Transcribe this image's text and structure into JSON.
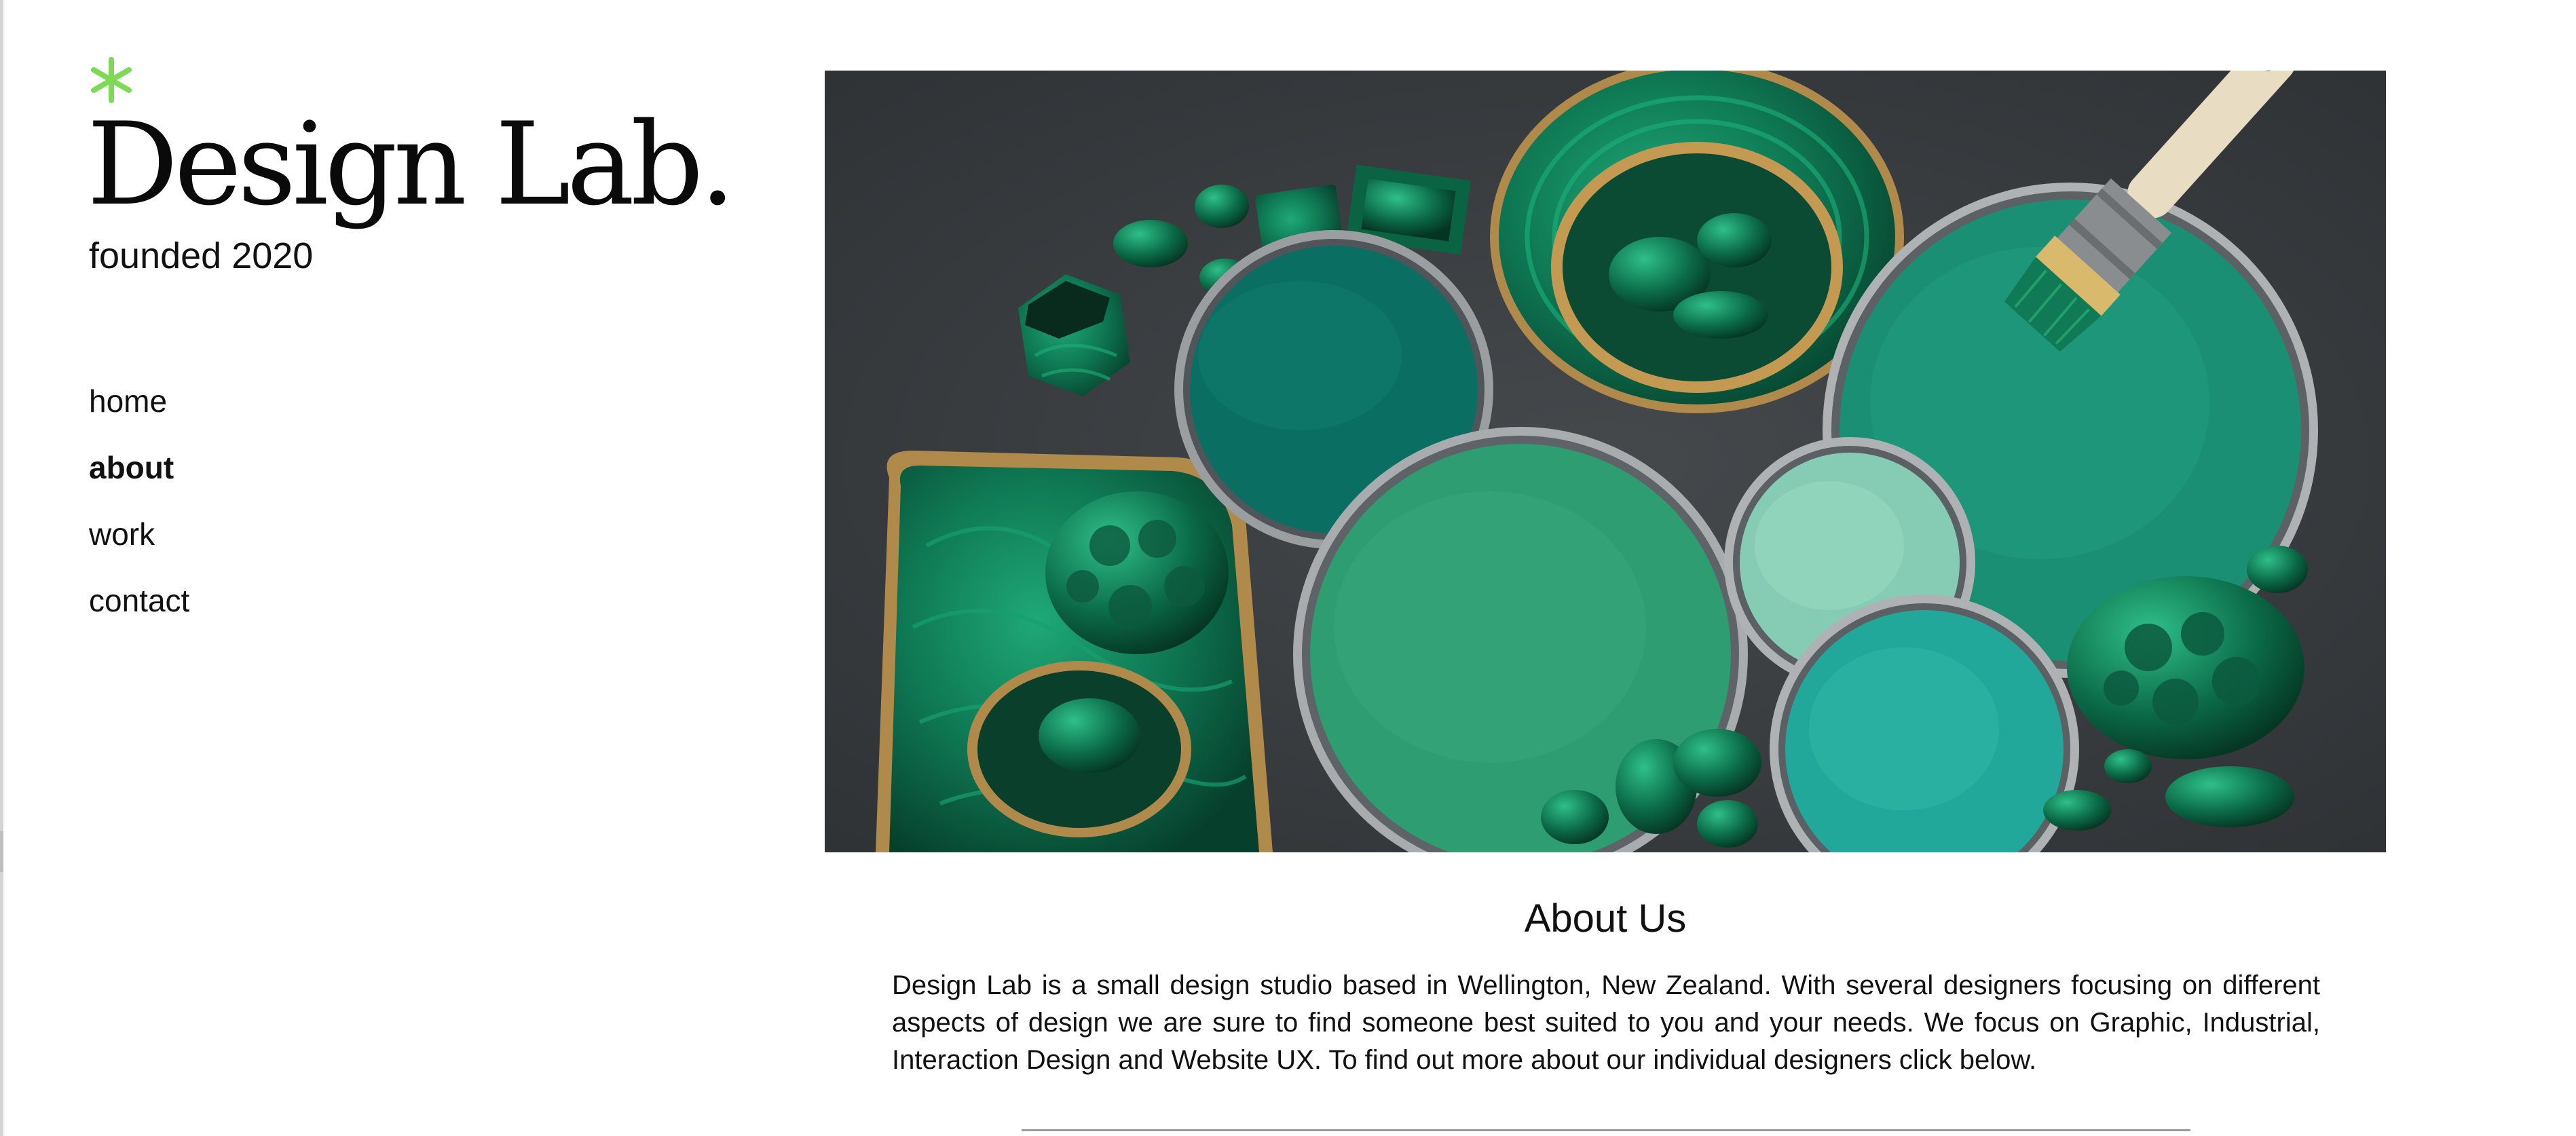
{
  "brand": {
    "asterisk_icon": "asterisk-icon",
    "asterisk_color": "#7ed957",
    "title": "Design Lab.",
    "tagline": "founded 2020"
  },
  "nav": {
    "items": [
      {
        "label": "home",
        "active": false
      },
      {
        "label": "about",
        "active": true
      },
      {
        "label": "work",
        "active": false
      },
      {
        "label": "contact",
        "active": false
      }
    ]
  },
  "hero": {
    "image_subject": "malachite stones and green paint tins with paintbrush"
  },
  "about": {
    "heading": "About Us",
    "body": "Design Lab is a small design studio based in Wellington, New Zealand. With several designers focusing on different aspects of design we are sure to find someone best suited to you and your needs. We focus on Graphic, Industrial, Interaction Design and Website UX. To find out more about our individual designers click below."
  },
  "colors": {
    "accent": "#7ed957",
    "text": "#111111",
    "background": "#ffffff"
  }
}
